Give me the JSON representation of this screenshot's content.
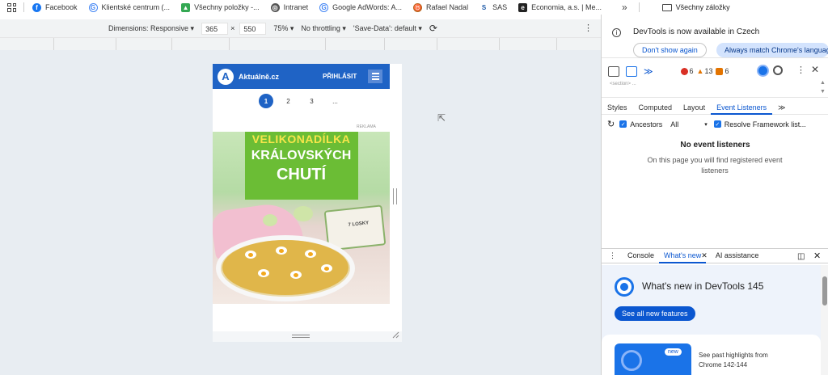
{
  "bookmarks": {
    "items": [
      {
        "label": "Facebook",
        "icon": "facebook-icon",
        "color": "#1877f2"
      },
      {
        "label": "Klientské centrum (...",
        "icon": "google-icon",
        "color": "#4285f4"
      },
      {
        "label": "Všechny položky -...",
        "icon": "drive-icon",
        "color": "#34a853"
      },
      {
        "label": "Intranet",
        "icon": "globe-icon",
        "color": "#555555"
      },
      {
        "label": "Google AdWords: A...",
        "icon": "google-icon",
        "color": "#4285f4"
      },
      {
        "label": "Rafael Nadal",
        "icon": "bull-icon",
        "color": "#b5651d"
      },
      {
        "label": "SAS",
        "icon": "sas-icon",
        "color": "#1e5aa8"
      },
      {
        "label": "Economia, a.s. | Me...",
        "icon": "economia-icon",
        "color": "#222222"
      }
    ],
    "more": "»",
    "folder_label": "Všechny záložky"
  },
  "device_toolbar": {
    "dimensions_label": "Dimensions: Responsive ▾",
    "width": "365",
    "times": "×",
    "height": "550",
    "zoom": "75% ▾",
    "throttling": "No throttling ▾",
    "save_data": "'Save-Data': default ▾"
  },
  "site": {
    "logo_letter": "A",
    "name": "Aktuálně.cz",
    "login": "PŘIHLÁSIT",
    "pages": [
      "1",
      "2",
      "3",
      "..."
    ],
    "ad_label": "REKLAMA",
    "ad_line1": "VELIKONADÍLKA",
    "ad_line2": "KRÁLOVSKÝCH",
    "ad_line3": "CHUTÍ",
    "box_text": "7 LOSKY"
  },
  "devtools": {
    "info_text": "DevTools is now available in Czech",
    "dont_show": "Don't show again",
    "always_match": "Always match Chrome's language",
    "errors": "6",
    "warnings": "13",
    "issues": "6",
    "dom_fragment": "<section> ...",
    "tabs": [
      "Styles",
      "Computed",
      "Layout",
      "Event Listeners"
    ],
    "ancestors": "Ancestors",
    "filter": "All",
    "resolve": "Resolve Framework list...",
    "no_listeners": "No event listeners",
    "no_listeners_desc": "On this page you will find registered event listeners",
    "drawer_tabs": [
      "Console",
      "What's new",
      "AI assistance"
    ],
    "whats_new_title": "What's new in DevTools 145",
    "see_all": "See all new features",
    "new_badge": "new",
    "past_highlights": "See past highlights from Chrome 142-144"
  }
}
